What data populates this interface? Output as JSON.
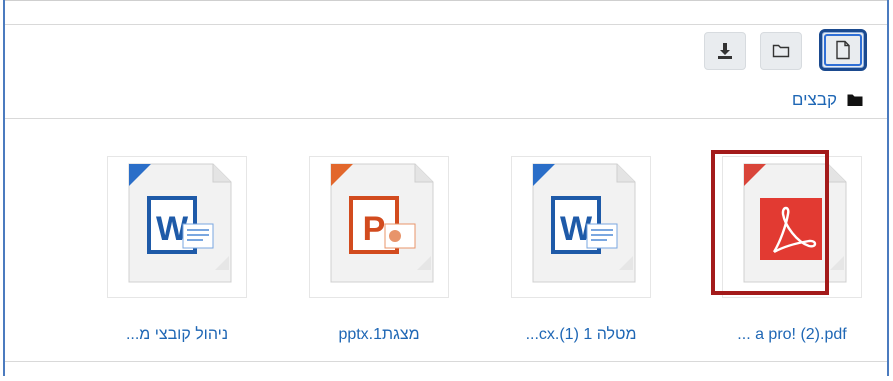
{
  "toolbar": {
    "download_icon": "download-icon",
    "folder_icon": "folder-icon",
    "file_icon": "file-icon",
    "active_view": "icons"
  },
  "breadcrumb": {
    "label": "קבצים",
    "icon": "folder-icon"
  },
  "files": [
    {
      "name": "... a pro! (2).pdf",
      "type": "pdf",
      "selected": true
    },
    {
      "name": "...cx.(1) מטלה 1",
      "type": "docx",
      "selected": false
    },
    {
      "name": "pptx.1מצגת",
      "type": "pptx",
      "selected": false
    },
    {
      "name": "...ניהול קובצי מ",
      "type": "docx",
      "selected": false
    }
  ],
  "colors": {
    "frame_border": "#4b7bbf",
    "link": "#1f67b5",
    "selection": "#a31a1a",
    "active_button_border": "#1b4a8f"
  }
}
